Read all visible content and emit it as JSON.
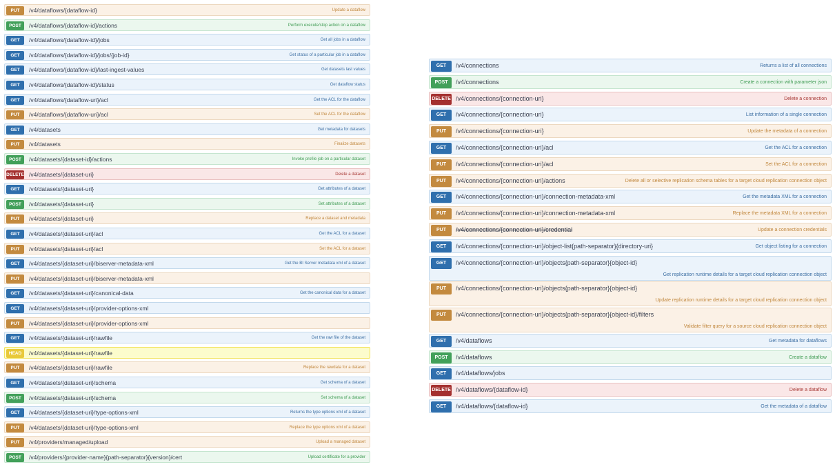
{
  "colors": {
    "get": "#2f6fad",
    "post": "#42a05a",
    "put": "#c38a3f",
    "delete": "#a4302f",
    "head": "#e9c93a"
  },
  "left_ops": [
    {
      "method": "PUT",
      "path": "/v4/dataflows/{dataflow-id}",
      "summary": "Update a dataflow"
    },
    {
      "method": "POST",
      "path": "/v4/dataflows/{dataflow-id}/actions",
      "summary": "Perform execute/stop action on a dataflow"
    },
    {
      "method": "GET",
      "path": "/v4/dataflows/{dataflow-id}/jobs",
      "summary": "Get all jobs in a dataflow"
    },
    {
      "method": "GET",
      "path": "/v4/dataflows/{dataflow-id}/jobs/{job-id}",
      "summary": "Get status of a particular job in a dataflow"
    },
    {
      "method": "GET",
      "path": "/v4/dataflows/{dataflow-id}/last-ingest-values",
      "summary": "Get datasets last values"
    },
    {
      "method": "GET",
      "path": "/v4/dataflows/{dataflow-id}/status",
      "summary": "Get dataflow status"
    },
    {
      "method": "GET",
      "path": "/v4/dataflows/{dataflow-uri}/acl",
      "summary": "Get the ACL for the dataflow"
    },
    {
      "method": "PUT",
      "path": "/v4/dataflows/{dataflow-uri}/acl",
      "summary": "Set the ACL for the dataflow"
    },
    {
      "method": "GET",
      "path": "/v4/datasets",
      "summary": "Get metadata for datasets"
    },
    {
      "method": "PUT",
      "path": "/v4/datasets",
      "summary": "Finalize datasets"
    },
    {
      "method": "POST",
      "path": "/v4/datasets/{dataset-id}/actions",
      "summary": "Invoke profile job on a particular dataset"
    },
    {
      "method": "DELETE",
      "path": "/v4/datasets/{dataset-uri}",
      "summary": "Delete a dataset"
    },
    {
      "method": "GET",
      "path": "/v4/datasets/{dataset-uri}",
      "summary": "Get attributes of a dataset"
    },
    {
      "method": "POST",
      "path": "/v4/datasets/{dataset-uri}",
      "summary": "Set attributes of a dataset"
    },
    {
      "method": "PUT",
      "path": "/v4/datasets/{dataset-uri}",
      "summary": "Replace a dataset and metadata"
    },
    {
      "method": "GET",
      "path": "/v4/datasets/{dataset-uri}/acl",
      "summary": "Get the ACL for a dataset"
    },
    {
      "method": "PUT",
      "path": "/v4/datasets/{dataset-uri}/acl",
      "summary": "Set the ACL for a dataset"
    },
    {
      "method": "GET",
      "path": "/v4/datasets/{dataset-uri}/biserver-metadata-xml",
      "summary": "Get the BI Server metadata xml of a dataset"
    },
    {
      "method": "PUT",
      "path": "/v4/datasets/{dataset-uri}/biserver-metadata-xml",
      "summary": ""
    },
    {
      "method": "GET",
      "path": "/v4/datasets/{dataset-uri}/canonical-data",
      "summary": "Get the canonical data for a dataset"
    },
    {
      "method": "GET",
      "path": "/v4/datasets/{dataset-uri}/provider-options-xml",
      "summary": ""
    },
    {
      "method": "PUT",
      "path": "/v4/datasets/{dataset-uri}/provider-options-xml",
      "summary": ""
    },
    {
      "method": "GET",
      "path": "/v4/datasets/{dataset-uri}/rawfile",
      "summary": "Get the raw file of the dataset"
    },
    {
      "method": "HEAD",
      "path": "/v4/datasets/{dataset-uri}/rawfile",
      "summary": ""
    },
    {
      "method": "PUT",
      "path": "/v4/datasets/{dataset-uri}/rawfile",
      "summary": "Replace the rawdata for a dataset"
    },
    {
      "method": "GET",
      "path": "/v4/datasets/{dataset-uri}/schema",
      "summary": "Get schema of a dataset"
    },
    {
      "method": "POST",
      "path": "/v4/datasets/{dataset-uri}/schema",
      "summary": "Set schema of a dataset"
    },
    {
      "method": "GET",
      "path": "/v4/datasets/{dataset-uri}/type-options-xml",
      "summary": "Returns the type options xml of a dataset"
    },
    {
      "method": "PUT",
      "path": "/v4/datasets/{dataset-uri}/type-options-xml",
      "summary": "Replace the type options xml of a dataset"
    },
    {
      "method": "PUT",
      "path": "/v4/providers/managed/upload",
      "summary": "Upload a managed dataset"
    },
    {
      "method": "POST",
      "path": "/v4/providers/{provider-name}{path-separator}{version}/cert",
      "summary": "Upload certificate for a provider"
    }
  ],
  "right_ops": [
    {
      "method": "GET",
      "path": "/v4/connections",
      "summary": "Returns a list of all connections"
    },
    {
      "method": "POST",
      "path": "/v4/connections",
      "summary": "Create a connection with parameter json"
    },
    {
      "method": "DELETE",
      "path": "/v4/connections/{connection-uri}",
      "summary": "Delete a connection"
    },
    {
      "method": "GET",
      "path": "/v4/connections/{connection-uri}",
      "summary": "List information of a single connection"
    },
    {
      "method": "PUT",
      "path": "/v4/connections/{connection-uri}",
      "summary": "Update the metadata of a connection"
    },
    {
      "method": "GET",
      "path": "/v4/connections/{connection-uri}/acl",
      "summary": "Get the ACL for a connection"
    },
    {
      "method": "PUT",
      "path": "/v4/connections/{connection-uri}/acl",
      "summary": "Set the ACL for a connection"
    },
    {
      "method": "PUT",
      "path": "/v4/connections/{connection-uri}/actions",
      "summary": "Delete all or selective replication schema tables for a target cloud replication connection object"
    },
    {
      "method": "GET",
      "path": "/v4/connections/{connection-uri}/connection-metadata-xml",
      "summary": "Get the metadata XML for a connection"
    },
    {
      "method": "PUT",
      "path": "/v4/connections/{connection-uri}/connection-metadata-xml",
      "summary": "Replace the metadata XML for a connection"
    },
    {
      "method": "PUT",
      "path": "/v4/connections/{connection-uri}/credential",
      "summary": "Update a connection credentials",
      "deprecated": true
    },
    {
      "method": "GET",
      "path": "/v4/connections/{connection-uri}/object-list{path-separator}{directory-uri}",
      "summary": "Get object listing for a connection"
    },
    {
      "method": "GET",
      "path": "/v4/connections/{connection-uri}/objects{path-separator}{object-id}",
      "summary": "Get replication runtime details for a target cloud replication connection object",
      "tall": true
    },
    {
      "method": "PUT",
      "path": "/v4/connections/{connection-uri}/objects{path-separator}{object-id}",
      "summary": "Update replication runtime details for a target cloud replication connection object",
      "tall": true
    },
    {
      "method": "PUT",
      "path": "/v4/connections/{connection-uri}/objects{path-separator}{object-id}/filters",
      "summary": "Validate filter query for a source cloud replication connection object",
      "tall": true
    },
    {
      "method": "GET",
      "path": "/v4/dataflows",
      "summary": "Get metadata for dataflows"
    },
    {
      "method": "POST",
      "path": "/v4/dataflows",
      "summary": "Create a dataflow"
    },
    {
      "method": "GET",
      "path": "/v4/dataflows/jobs",
      "summary": ""
    },
    {
      "method": "DELETE",
      "path": "/v4/dataflows/{dataflow-id}",
      "summary": "Delete a dataflow"
    },
    {
      "method": "GET",
      "path": "/v4/dataflows/{dataflow-id}",
      "summary": "Get the metadata of a dataflow"
    }
  ]
}
